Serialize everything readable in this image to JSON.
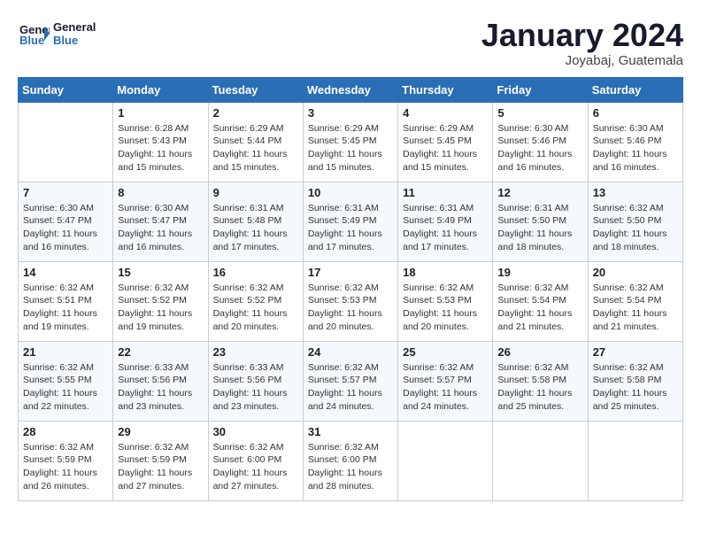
{
  "brand": {
    "name_part1": "General",
    "name_part2": "Blue"
  },
  "header": {
    "month_year": "January 2024",
    "location": "Joyabaj, Guatemala"
  },
  "weekdays": [
    "Sunday",
    "Monday",
    "Tuesday",
    "Wednesday",
    "Thursday",
    "Friday",
    "Saturday"
  ],
  "weeks": [
    [
      {
        "day": "",
        "info": ""
      },
      {
        "day": "1",
        "info": "Sunrise: 6:28 AM\nSunset: 5:43 PM\nDaylight: 11 hours\nand 15 minutes."
      },
      {
        "day": "2",
        "info": "Sunrise: 6:29 AM\nSunset: 5:44 PM\nDaylight: 11 hours\nand 15 minutes."
      },
      {
        "day": "3",
        "info": "Sunrise: 6:29 AM\nSunset: 5:45 PM\nDaylight: 11 hours\nand 15 minutes."
      },
      {
        "day": "4",
        "info": "Sunrise: 6:29 AM\nSunset: 5:45 PM\nDaylight: 11 hours\nand 15 minutes."
      },
      {
        "day": "5",
        "info": "Sunrise: 6:30 AM\nSunset: 5:46 PM\nDaylight: 11 hours\nand 16 minutes."
      },
      {
        "day": "6",
        "info": "Sunrise: 6:30 AM\nSunset: 5:46 PM\nDaylight: 11 hours\nand 16 minutes."
      }
    ],
    [
      {
        "day": "7",
        "info": "Sunrise: 6:30 AM\nSunset: 5:47 PM\nDaylight: 11 hours\nand 16 minutes."
      },
      {
        "day": "8",
        "info": "Sunrise: 6:30 AM\nSunset: 5:47 PM\nDaylight: 11 hours\nand 16 minutes."
      },
      {
        "day": "9",
        "info": "Sunrise: 6:31 AM\nSunset: 5:48 PM\nDaylight: 11 hours\nand 17 minutes."
      },
      {
        "day": "10",
        "info": "Sunrise: 6:31 AM\nSunset: 5:49 PM\nDaylight: 11 hours\nand 17 minutes."
      },
      {
        "day": "11",
        "info": "Sunrise: 6:31 AM\nSunset: 5:49 PM\nDaylight: 11 hours\nand 17 minutes."
      },
      {
        "day": "12",
        "info": "Sunrise: 6:31 AM\nSunset: 5:50 PM\nDaylight: 11 hours\nand 18 minutes."
      },
      {
        "day": "13",
        "info": "Sunrise: 6:32 AM\nSunset: 5:50 PM\nDaylight: 11 hours\nand 18 minutes."
      }
    ],
    [
      {
        "day": "14",
        "info": "Sunrise: 6:32 AM\nSunset: 5:51 PM\nDaylight: 11 hours\nand 19 minutes."
      },
      {
        "day": "15",
        "info": "Sunrise: 6:32 AM\nSunset: 5:52 PM\nDaylight: 11 hours\nand 19 minutes."
      },
      {
        "day": "16",
        "info": "Sunrise: 6:32 AM\nSunset: 5:52 PM\nDaylight: 11 hours\nand 20 minutes."
      },
      {
        "day": "17",
        "info": "Sunrise: 6:32 AM\nSunset: 5:53 PM\nDaylight: 11 hours\nand 20 minutes."
      },
      {
        "day": "18",
        "info": "Sunrise: 6:32 AM\nSunset: 5:53 PM\nDaylight: 11 hours\nand 20 minutes."
      },
      {
        "day": "19",
        "info": "Sunrise: 6:32 AM\nSunset: 5:54 PM\nDaylight: 11 hours\nand 21 minutes."
      },
      {
        "day": "20",
        "info": "Sunrise: 6:32 AM\nSunset: 5:54 PM\nDaylight: 11 hours\nand 21 minutes."
      }
    ],
    [
      {
        "day": "21",
        "info": "Sunrise: 6:32 AM\nSunset: 5:55 PM\nDaylight: 11 hours\nand 22 minutes."
      },
      {
        "day": "22",
        "info": "Sunrise: 6:33 AM\nSunset: 5:56 PM\nDaylight: 11 hours\nand 23 minutes."
      },
      {
        "day": "23",
        "info": "Sunrise: 6:33 AM\nSunset: 5:56 PM\nDaylight: 11 hours\nand 23 minutes."
      },
      {
        "day": "24",
        "info": "Sunrise: 6:32 AM\nSunset: 5:57 PM\nDaylight: 11 hours\nand 24 minutes."
      },
      {
        "day": "25",
        "info": "Sunrise: 6:32 AM\nSunset: 5:57 PM\nDaylight: 11 hours\nand 24 minutes."
      },
      {
        "day": "26",
        "info": "Sunrise: 6:32 AM\nSunset: 5:58 PM\nDaylight: 11 hours\nand 25 minutes."
      },
      {
        "day": "27",
        "info": "Sunrise: 6:32 AM\nSunset: 5:58 PM\nDaylight: 11 hours\nand 25 minutes."
      }
    ],
    [
      {
        "day": "28",
        "info": "Sunrise: 6:32 AM\nSunset: 5:59 PM\nDaylight: 11 hours\nand 26 minutes."
      },
      {
        "day": "29",
        "info": "Sunrise: 6:32 AM\nSunset: 5:59 PM\nDaylight: 11 hours\nand 27 minutes."
      },
      {
        "day": "30",
        "info": "Sunrise: 6:32 AM\nSunset: 6:00 PM\nDaylight: 11 hours\nand 27 minutes."
      },
      {
        "day": "31",
        "info": "Sunrise: 6:32 AM\nSunset: 6:00 PM\nDaylight: 11 hours\nand 28 minutes."
      },
      {
        "day": "",
        "info": ""
      },
      {
        "day": "",
        "info": ""
      },
      {
        "day": "",
        "info": ""
      }
    ]
  ]
}
